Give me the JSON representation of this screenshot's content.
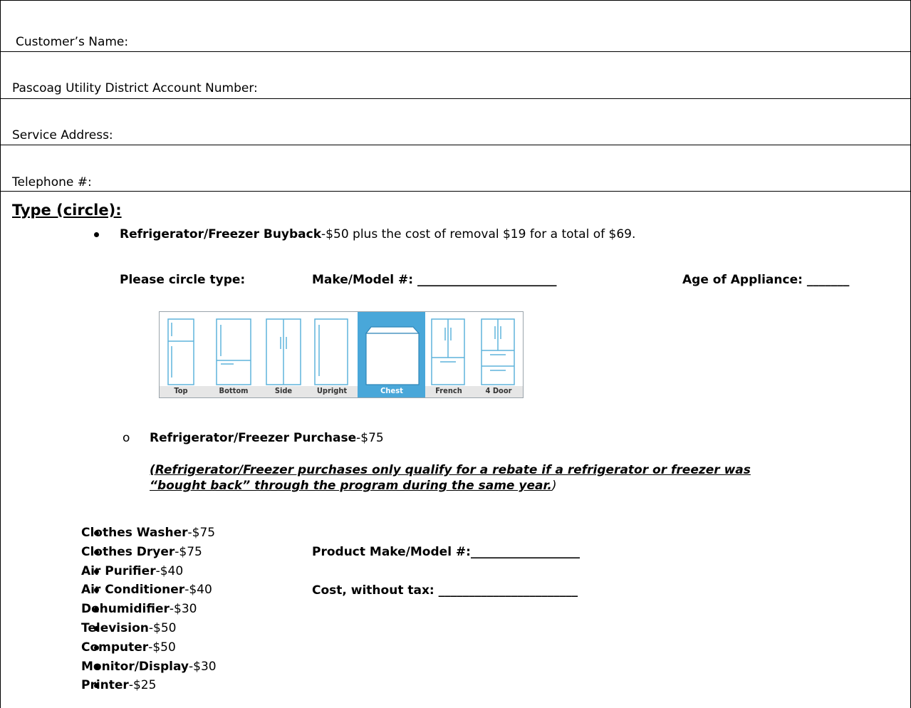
{
  "fields": {
    "customer_name": "Customer’s Name:",
    "account_number": "Pascoag Utility District Account Number:",
    "service_address": "Service Address:",
    "telephone": "Telephone #:"
  },
  "type_heading": "Type (circle):",
  "buyback": {
    "label": "Refrigerator/Freezer Buyback",
    "detail": "-$50 plus the cost of removal $19 for a total of $69."
  },
  "circle_row": {
    "type_label": "Please circle type:",
    "model_label": "Make/Model #: _______________________",
    "age_label": "Age of Appliance: _______"
  },
  "fridge_types": {
    "items": [
      "Top",
      "Bottom",
      "Side",
      "Upright",
      "Chest",
      "French",
      "4 Door"
    ],
    "selected": "Chest",
    "colors": {
      "line": "#5fb4dc",
      "selected_bg": "#49a7d9",
      "label_bg": "#e8e8e8"
    }
  },
  "purchase": {
    "label": "Refrigerator/Freezer Purchase",
    "price": "-$75",
    "note_line1": "(Refrigerator/Freezer purchases only qualify for a rebate if a refrigerator or freezer was",
    "note_line2": "“bought back” through the program during the same year.",
    "note_close": ")"
  },
  "items": [
    {
      "label": "Clothes Washer",
      "price": "-$75"
    },
    {
      "label": "Clothes Dryer",
      "price": "-$75"
    },
    {
      "label": "Air Purifier",
      "price": "-$40"
    },
    {
      "label": "Air Conditioner",
      "price": "-$40"
    },
    {
      "label": "Dehumidifier",
      "price": "-$30"
    },
    {
      "label": "Television",
      "price": "-$50"
    },
    {
      "label": "Computer",
      "price": "-$50"
    },
    {
      "label": "Monitor/Display",
      "price": "-$30"
    },
    {
      "label": "Printer",
      "price": "-$25"
    }
  ],
  "product_model_label": "Product Make/Model #:__________________",
  "cost_label": "Cost, without tax: _______________________"
}
